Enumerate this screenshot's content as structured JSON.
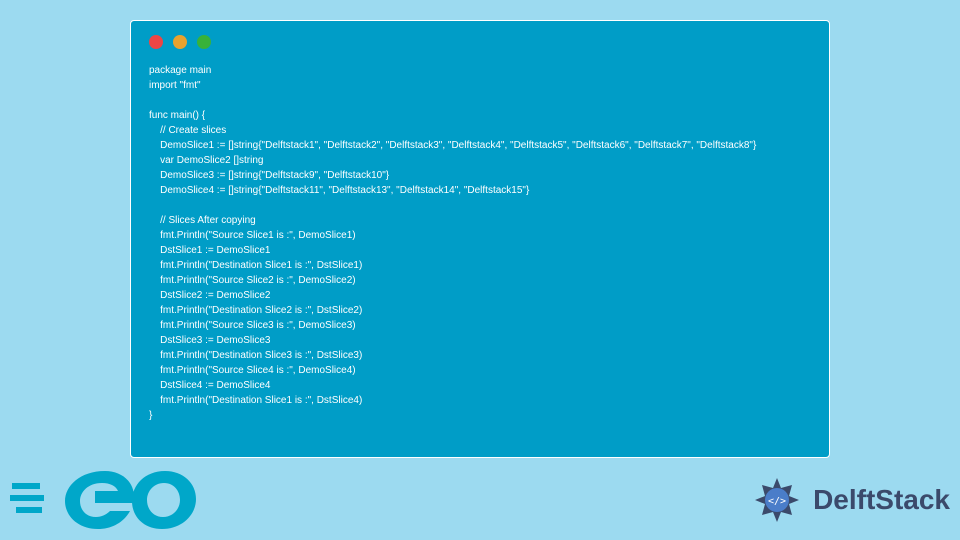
{
  "code": {
    "lines": [
      "package main",
      "import \"fmt\"",
      "",
      "func main() {",
      "    // Create slices",
      "    DemoSlice1 := []string{\"Delftstack1\", \"Delftstack2\", \"Delftstack3\", \"Delftstack4\", \"Delftstack5\", \"Delftstack6\", \"Delftstack7\", \"Delftstack8\"}",
      "    var DemoSlice2 []string",
      "    DemoSlice3 := []string{\"Delftstack9\", \"Delftstack10\"}",
      "    DemoSlice4 := []string{\"Delftstack11\", \"Delftstack13\", \"Delftstack14\", \"Delftstack15\"}",
      "",
      "    // Slices After copying",
      "    fmt.Println(\"Source Slice1 is :\", DemoSlice1)",
      "    DstSlice1 := DemoSlice1",
      "    fmt.Println(\"Destination Slice1 is :\", DstSlice1)",
      "    fmt.Println(\"Source Slice2 is :\", DemoSlice2)",
      "    DstSlice2 := DemoSlice2",
      "    fmt.Println(\"Destination Slice2 is :\", DstSlice2)",
      "    fmt.Println(\"Source Slice3 is :\", DemoSlice3)",
      "    DstSlice3 := DemoSlice3",
      "    fmt.Println(\"Destination Slice3 is :\", DstSlice3)",
      "    fmt.Println(\"Source Slice4 is :\", DemoSlice4)",
      "    DstSlice4 := DemoSlice4",
      "    fmt.Println(\"Destination Slice1 is :\", DstSlice4)",
      "}"
    ]
  },
  "branding": {
    "delft_text": "DelftStack"
  }
}
